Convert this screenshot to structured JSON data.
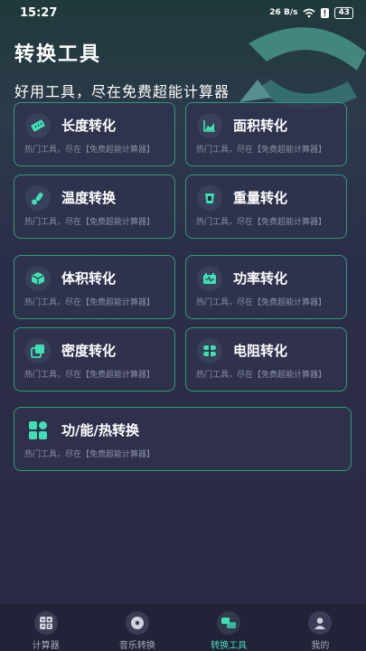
{
  "status": {
    "time": "15:27",
    "net_speed": "26 B/s",
    "battery": "43"
  },
  "header": {
    "title": "转换工具",
    "subtitle": "好用工具，尽在免费超能计算器"
  },
  "tools": [
    {
      "title": "长度转化",
      "desc": "热门工具，尽在【免费超能计算器】",
      "icon": "ruler-icon"
    },
    {
      "title": "面积转化",
      "desc": "热门工具，尽在【免费超能计算器】",
      "icon": "area-chart-icon"
    },
    {
      "title": "温度转换",
      "desc": "热门工具，尽在【免费超能计算器】",
      "icon": "thermometer-icon"
    },
    {
      "title": "重量转化",
      "desc": "热门工具，尽在【免费超能计算器】",
      "icon": "weight-icon"
    },
    {
      "title": "体积转化",
      "desc": "热门工具，尽在【免费超能计算器】",
      "icon": "cube-icon"
    },
    {
      "title": "功率转化",
      "desc": "热门工具，尽在【免费超能计算器】",
      "icon": "battery-power-icon"
    },
    {
      "title": "密度转化",
      "desc": "热门工具，尽在【免费超能计算器】",
      "icon": "density-icon"
    },
    {
      "title": "电阻转化",
      "desc": "热门工具，尽在【免费超能计算器】",
      "icon": "resistor-icon"
    },
    {
      "title": "功/能/热转换",
      "desc": "热门工具，尽在【免费超能计算器】",
      "icon": "grid-apps-icon"
    }
  ],
  "nav": [
    {
      "label": "计算器",
      "icon": "calculator-icon"
    },
    {
      "label": "音乐转换",
      "icon": "music-disc-icon"
    },
    {
      "label": "转换工具",
      "icon": "convert-icon",
      "active": true
    },
    {
      "label": "我的",
      "icon": "user-icon"
    }
  ],
  "colors": {
    "accent": "#3ee0b4",
    "border": "#2e9c7a",
    "background": "#2a2a45"
  }
}
